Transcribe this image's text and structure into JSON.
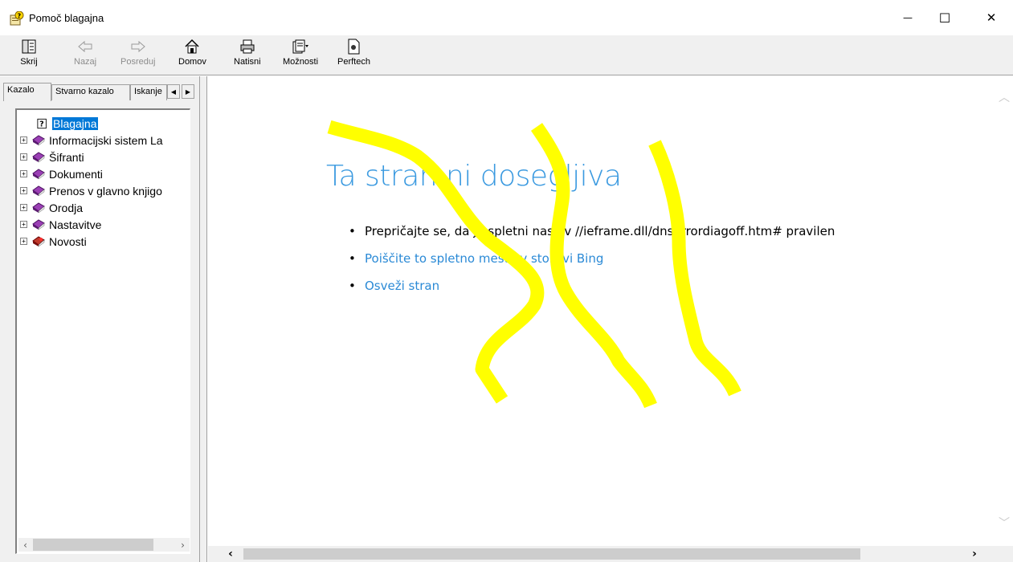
{
  "window": {
    "title": "Pomoč blagajna",
    "minimize_glyph": "—",
    "maximize_glyph": "☐",
    "close_glyph": "✕"
  },
  "toolbar": {
    "hide_label": "Skrij",
    "back_label": "Nazaj",
    "forward_label": "Posreduj",
    "home_label": "Domov",
    "print_label": "Natisni",
    "options_label": "Možnosti",
    "perftech_label": "Perftech"
  },
  "tabs": {
    "contents": "Kazalo",
    "index": "Stvarno kazalo",
    "search": "Iskanje",
    "scroll_left": "◀",
    "scroll_right": "▶"
  },
  "tree": {
    "items": [
      {
        "label": "Blagajna",
        "icon": "help-page-icon",
        "selected": true
      },
      {
        "label": "Informacijski sistem La",
        "icon": "book-icon"
      },
      {
        "label": "Šifranti",
        "icon": "book-icon"
      },
      {
        "label": "Dokumenti",
        "icon": "book-icon"
      },
      {
        "label": "Prenos v glavno knjigo",
        "icon": "book-icon"
      },
      {
        "label": "Orodja",
        "icon": "book-icon"
      },
      {
        "label": "Nastavitve",
        "icon": "book-icon"
      },
      {
        "label": "Novosti",
        "icon": "book-red-icon"
      }
    ],
    "expand_glyph": "+"
  },
  "content": {
    "heading": "Ta stran ni dosegljiva",
    "bullets": [
      {
        "text": "Prepričajte se, da je spletni naslov //ieframe.dll/dnserrordiagoff.htm# pravilen",
        "link": false
      },
      {
        "text": "Poiščite to spletno mesto v storitvi Bing",
        "link": true
      },
      {
        "text": "Osveži stran",
        "link": true
      }
    ]
  },
  "scrollbars": {
    "left": "‹",
    "right": "›",
    "up": "︿",
    "down": "﹀"
  },
  "colors": {
    "heading": "#3b9ae0",
    "link": "#2b8ad6",
    "selection": "#0078d7",
    "scribble": "#ffff00"
  }
}
